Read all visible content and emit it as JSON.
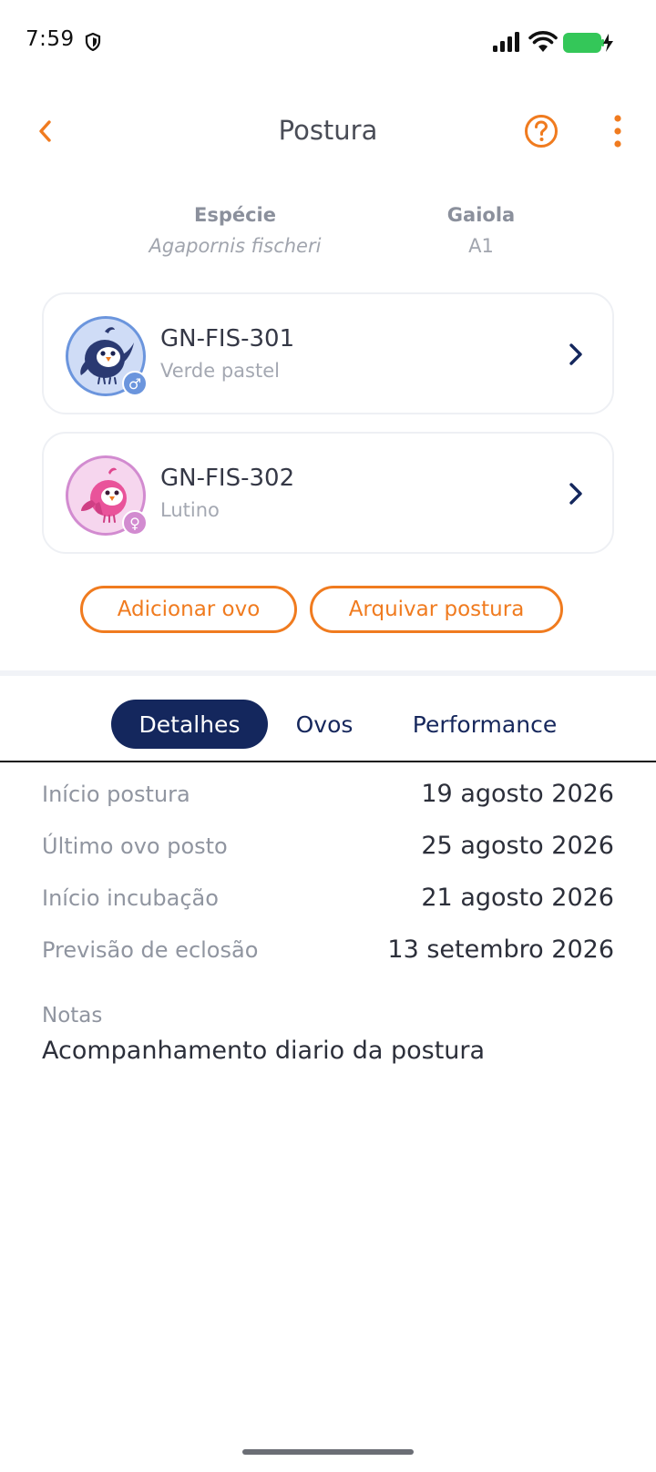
{
  "status_bar": {
    "time": "7:59"
  },
  "header": {
    "title": "Postura"
  },
  "meta": {
    "species_label": "Espécie",
    "species_value": "Agapornis fischeri",
    "cage_label": "Gaiola",
    "cage_value": "A1"
  },
  "birds": [
    {
      "ring": "GN-FIS-301",
      "color": "Verde pastel",
      "sex": "male",
      "sex_symbol": "♂"
    },
    {
      "ring": "GN-FIS-302",
      "color": "Lutino",
      "sex": "female",
      "sex_symbol": "♀"
    }
  ],
  "actions": {
    "add_egg": "Adicionar ovo",
    "archive": "Arquivar postura"
  },
  "tabs": [
    {
      "label": "Detalhes",
      "active": true
    },
    {
      "label": "Ovos",
      "active": false
    },
    {
      "label": "Performance",
      "active": false
    }
  ],
  "details": [
    {
      "label": "Início postura",
      "value": "19 agosto 2026"
    },
    {
      "label": "Último ovo posto",
      "value": "25 agosto 2026"
    },
    {
      "label": "Início incubação",
      "value": "21 agosto 2026"
    },
    {
      "label": "Previsão de eclosão",
      "value": "13 setembro 2026"
    }
  ],
  "notes": {
    "label": "Notas",
    "value": "Acompanhamento diario da postura"
  },
  "colors": {
    "accent": "#f07b1f",
    "navy": "#14275d",
    "male": "#6b95dd",
    "female": "#d28bd0",
    "battery": "#34c759"
  }
}
